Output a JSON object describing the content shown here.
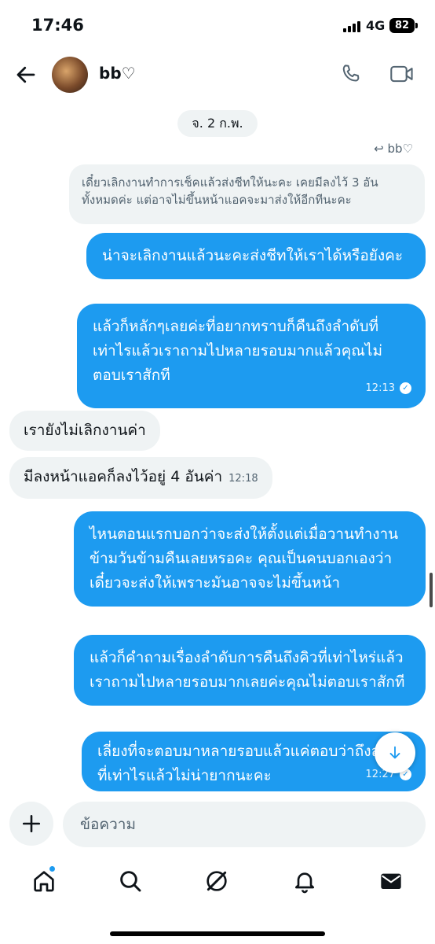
{
  "status": {
    "time": "17:46",
    "network": "4G",
    "battery": "82"
  },
  "header": {
    "contact_name": "bb♡"
  },
  "chat": {
    "date_separator": "จ. 2 ก.พ.",
    "reply_to": "bb♡",
    "reply_quote": "เดี๋ยวเลิกงานทำการเช็คแล้วส่งชีทให้นะคะ เคยมีลงไว้ 3 อันทั้งหมดค่ะ แต่อาจไม่ขึ้นหน้าแอคจะมาส่งให้อีกทีนะคะ",
    "messages": [
      {
        "direction": "out",
        "text": "น่าจะเลิกงานแล้วนะคะส่งชีทให้เราได้หรือยังคะ"
      },
      {
        "direction": "out",
        "text": "แล้วก็หลักๆเลยค่ะที่อยากทราบก็คืนถึงลำดับที่เท่าไรแล้วเราถามไปหลายรอบมากแล้วคุณไม่ตอบเราสักที",
        "time": "12:13"
      },
      {
        "direction": "in",
        "text": "เรายังไม่เลิกงานค่า"
      },
      {
        "direction": "in",
        "text": "มีลงหน้าแอคก็ลงไว้อยู่ 4 อันค่า",
        "time": "12:18"
      },
      {
        "direction": "out",
        "text": "ไหนตอนแรกบอกว่าจะส่งให้ตั้งแต่เมื่อวานทำงานข้ามวันข้ามคืนเลยหรอคะ คุณเป็นคนบอกเองว่าเดี๋ยวจะส่งให้เพราะมันอาจจะไม่ขึ้นหน้า"
      },
      {
        "direction": "out",
        "text": "แล้วก็คำถามเรื่องลำดับการคืนถึงคิวที่เท่าไหร่แล้วเราถามไปหลายรอบมากเลยค่ะคุณไม่ตอบเราสักที"
      },
      {
        "direction": "out",
        "text": "เลี่ยงที่จะตอบมาหลายรอบแล้วแค่ตอบว่าถึงลำดับที่เท่าไรแล้วไม่น่ายากนะคะ",
        "time": "12:27"
      }
    ]
  },
  "composer": {
    "placeholder": "ข้อความ"
  },
  "nav": [
    "home-icon",
    "search-icon",
    "grok-icon",
    "notifications-icon",
    "messages-icon"
  ],
  "colors": {
    "accent": "#1d9bf0",
    "incoming_bg": "#eff3f4"
  }
}
